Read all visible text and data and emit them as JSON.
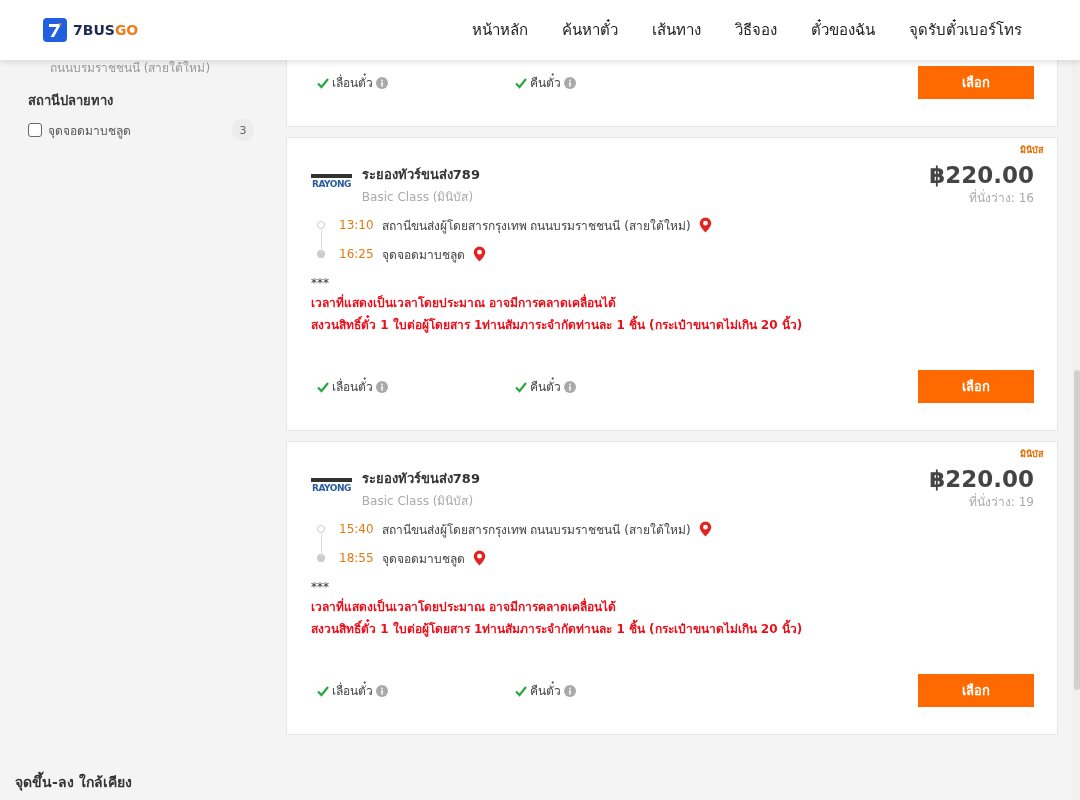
{
  "header": {
    "logo": {
      "main": "7BUS",
      "accent": "GO"
    },
    "nav": [
      {
        "label": "หน้าหลัก"
      },
      {
        "label": "ค้นหาตั๋ว"
      },
      {
        "label": "เส้นทาง"
      },
      {
        "label": "วิธีจอง"
      },
      {
        "label": "ตั๋วของฉัน"
      },
      {
        "label": "จุดรับตั๋วเบอร์โทร"
      }
    ]
  },
  "sidebar": {
    "cut_text": "ถนนบรมราชชนนี (สายใต้ใหม่)",
    "sections": [
      {
        "title": "สถานีปลายทาง",
        "options": [
          {
            "label": "จุดจอดมาบชลูด",
            "count": "3",
            "checked": false
          }
        ]
      }
    ]
  },
  "results": [
    {
      "kind": "partial",
      "features": [
        {
          "label": "เลื่อนตั๋ว",
          "available": true
        },
        {
          "label": "คืนตั๋ว",
          "available": true
        }
      ],
      "button": "เลือก"
    },
    {
      "kind": "full",
      "badge": "มินิบัส",
      "operator_logo": "RAYONG",
      "operator": "ระยองทัวร์ขนส่ง789",
      "class": "Basic Class (มินิบัส)",
      "price": "฿220.00",
      "seats": "ที่นั่งว่าง: 16",
      "stops": [
        {
          "kind": "origin",
          "time": "13:10",
          "station": "สถานีขนส่งผู้โดยสารกรุงเทพ ถนนบรมราชชนนี (สายใต้ใหม่)"
        },
        {
          "kind": "destination",
          "time": "16:25",
          "station": "จุดจอดมาบชลูด"
        }
      ],
      "note_mark": "***",
      "notes": [
        "เวลาที่แสดงเป็นเวลาโดยประมาณ อาจมีการคลาดเคลื่อนได้",
        "สงวนสิทธิ์ตั๋ว 1 ใบต่อผู้โดยสาร 1ท่านสัมภาระจำกัดท่านละ 1 ชิ้น (กระเป๋าขนาดไม่เกิน 20 นิ้ว)"
      ],
      "features": [
        {
          "label": "เลื่อนตั๋ว",
          "available": true
        },
        {
          "label": "คืนตั๋ว",
          "available": true
        }
      ],
      "button": "เลือก"
    },
    {
      "kind": "full",
      "badge": "มินิบัส",
      "operator_logo": "RAYONG",
      "operator": "ระยองทัวร์ขนส่ง789",
      "class": "Basic Class (มินิบัส)",
      "price": "฿220.00",
      "seats": "ที่นั่งว่าง: 19",
      "stops": [
        {
          "kind": "origin",
          "time": "15:40",
          "station": "สถานีขนส่งผู้โดยสารกรุงเทพ ถนนบรมราชชนนี (สายใต้ใหม่)"
        },
        {
          "kind": "destination",
          "time": "18:55",
          "station": "จุดจอดมาบชลูด"
        }
      ],
      "note_mark": "***",
      "notes": [
        "เวลาที่แสดงเป็นเวลาโดยประมาณ อาจมีการคลาดเคลื่อนได้",
        "สงวนสิทธิ์ตั๋ว 1 ใบต่อผู้โดยสาร 1ท่านสัมภาระจำกัดท่านละ 1 ชิ้น (กระเป๋าขนาดไม่เกิน 20 นิ้ว)"
      ],
      "features": [
        {
          "label": "เลื่อนตั๋ว",
          "available": true
        },
        {
          "label": "คืนตั๋ว",
          "available": true
        }
      ],
      "button": "เลือก"
    }
  ],
  "nearby": {
    "title": "จุดขึ้น-ลง ใกล้เคียง"
  }
}
